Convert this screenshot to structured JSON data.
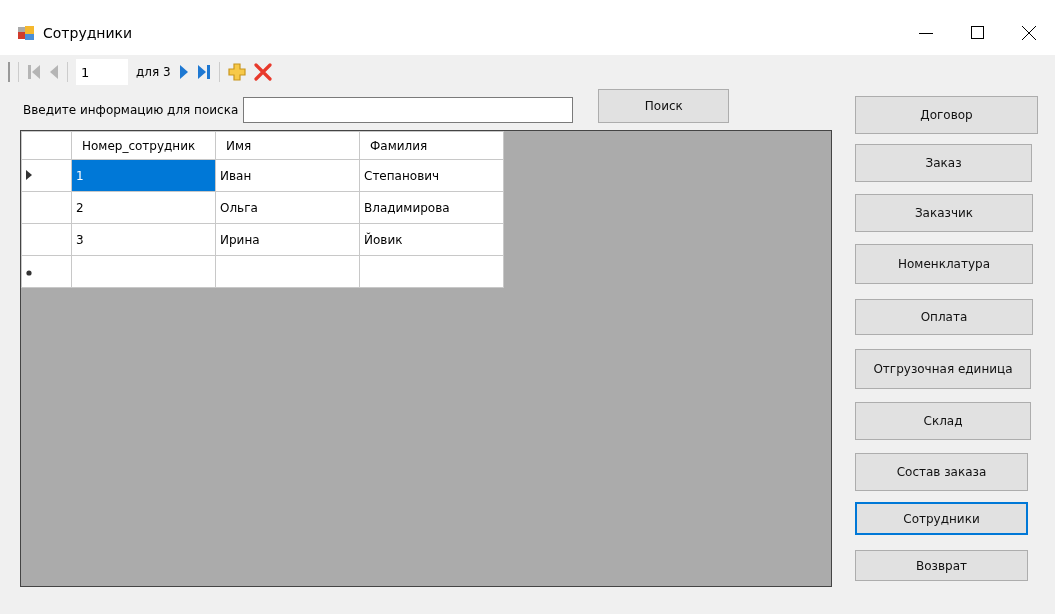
{
  "window": {
    "title": "Сотрудники"
  },
  "navigator": {
    "buttons": [
      {
        "kind": "first",
        "disabled": true
      },
      {
        "kind": "prev",
        "disabled": true
      },
      {
        "kind": "position",
        "value": "1"
      },
      {
        "kind": "count",
        "text": "для 3"
      },
      {
        "kind": "next",
        "disabled": false
      },
      {
        "kind": "last",
        "disabled": false
      },
      {
        "kind": "add",
        "disabled": false
      },
      {
        "kind": "delete",
        "disabled": false
      }
    ]
  },
  "search": {
    "label": "Введите информацию для поиска",
    "button": "Поиск"
  },
  "table": {
    "columns": [
      "Номер_сотрудник",
      "Имя",
      "Фамилия"
    ],
    "rows": [
      {
        "cells": [
          {
            "text": "1",
            "selected": true
          },
          {
            "text": "Иван",
            "selected": false
          },
          {
            "text": "Степанович",
            "selected": false
          }
        ],
        "current": true
      },
      {
        "cells": [
          {
            "text": "2",
            "selected": false
          },
          {
            "text": "Ольга",
            "selected": false
          },
          {
            "text": "Владимирова",
            "selected": false
          }
        ],
        "current": false
      },
      {
        "cells": [
          {
            "text": "3",
            "selected": false
          },
          {
            "text": "Ирина",
            "selected": false
          },
          {
            "text": "Йовик",
            "selected": false
          }
        ],
        "current": false
      }
    ],
    "new_row": true
  },
  "side_buttons": [
    {
      "label": "Договор",
      "focused": false
    },
    {
      "label": "Заказ",
      "focused": false
    },
    {
      "label": "Заказчик",
      "focused": false
    },
    {
      "label": "Номенклатура",
      "focused": false
    },
    {
      "label": "Оплата",
      "focused": false
    },
    {
      "label": "Отгрузочная единица",
      "focused": false
    },
    {
      "label": "Склад",
      "focused": false
    },
    {
      "label": "Состав заказа",
      "focused": false
    },
    {
      "label": "Сотрудники",
      "focused": true
    },
    {
      "label": "Возврат",
      "focused": false
    }
  ]
}
